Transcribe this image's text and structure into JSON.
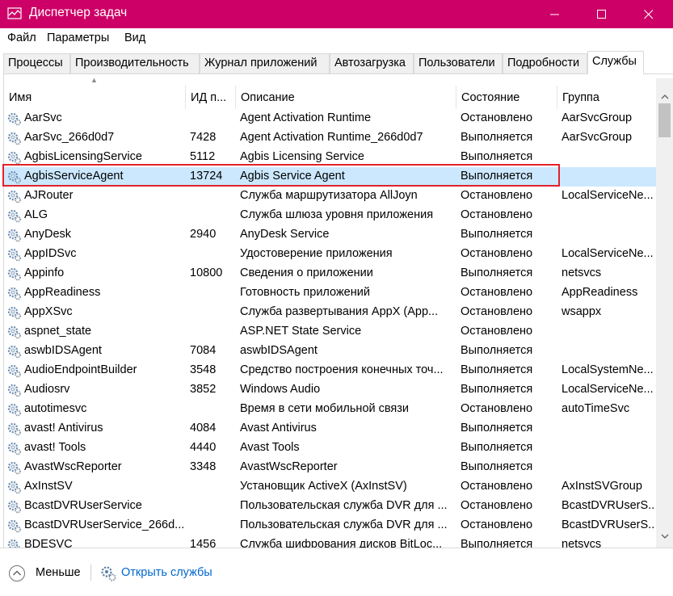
{
  "window": {
    "title": "Диспетчер задач"
  },
  "menu": [
    "Файл",
    "Параметры",
    "Вид"
  ],
  "tabs": [
    "Процессы",
    "Производительность",
    "Журнал приложений",
    "Автозагрузка",
    "Пользователи",
    "Подробности",
    "Службы"
  ],
  "active_tab": "Службы",
  "columns": {
    "name": "Имя",
    "pid": "ИД п...",
    "desc": "Описание",
    "state": "Состояние",
    "group": "Группа"
  },
  "sorted_column": "name",
  "rows": [
    {
      "name": "AarSvc",
      "pid": "",
      "desc": "Agent Activation Runtime",
      "state": "Остановлено",
      "group": "AarSvcGroup"
    },
    {
      "name": "AarSvc_266d0d7",
      "pid": "7428",
      "desc": "Agent Activation Runtime_266d0d7",
      "state": "Выполняется",
      "group": "AarSvcGroup"
    },
    {
      "name": "AgbisLicensingService",
      "pid": "5112",
      "desc": "Agbis Licensing Service",
      "state": "Выполняется",
      "group": ""
    },
    {
      "name": "AgbisServiceAgent",
      "pid": "13724",
      "desc": "Agbis Service Agent",
      "state": "Выполняется",
      "group": "",
      "selected": true
    },
    {
      "name": "AJRouter",
      "pid": "",
      "desc": "Служба маршрутизатора AllJoyn",
      "state": "Остановлено",
      "group": "LocalServiceNe..."
    },
    {
      "name": "ALG",
      "pid": "",
      "desc": "Служба шлюза уровня приложения",
      "state": "Остановлено",
      "group": ""
    },
    {
      "name": "AnyDesk",
      "pid": "2940",
      "desc": "AnyDesk Service",
      "state": "Выполняется",
      "group": ""
    },
    {
      "name": "AppIDSvc",
      "pid": "",
      "desc": "Удостоверение приложения",
      "state": "Остановлено",
      "group": "LocalServiceNe..."
    },
    {
      "name": "Appinfo",
      "pid": "10800",
      "desc": "Сведения о приложении",
      "state": "Выполняется",
      "group": "netsvcs"
    },
    {
      "name": "AppReadiness",
      "pid": "",
      "desc": "Готовность приложений",
      "state": "Остановлено",
      "group": "AppReadiness"
    },
    {
      "name": "AppXSvc",
      "pid": "",
      "desc": "Служба развертывания AppX (App...",
      "state": "Остановлено",
      "group": "wsappx"
    },
    {
      "name": "aspnet_state",
      "pid": "",
      "desc": "ASP.NET State Service",
      "state": "Остановлено",
      "group": ""
    },
    {
      "name": "aswbIDSAgent",
      "pid": "7084",
      "desc": "aswbIDSAgent",
      "state": "Выполняется",
      "group": ""
    },
    {
      "name": "AudioEndpointBuilder",
      "pid": "3548",
      "desc": "Средство построения конечных точ...",
      "state": "Выполняется",
      "group": "LocalSystemNe..."
    },
    {
      "name": "Audiosrv",
      "pid": "3852",
      "desc": "Windows Audio",
      "state": "Выполняется",
      "group": "LocalServiceNe..."
    },
    {
      "name": "autotimesvc",
      "pid": "",
      "desc": "Время в сети мобильной связи",
      "state": "Остановлено",
      "group": "autoTimeSvc"
    },
    {
      "name": "avast! Antivirus",
      "pid": "4084",
      "desc": "Avast Antivirus",
      "state": "Выполняется",
      "group": ""
    },
    {
      "name": "avast! Tools",
      "pid": "4440",
      "desc": "Avast Tools",
      "state": "Выполняется",
      "group": ""
    },
    {
      "name": "AvastWscReporter",
      "pid": "3348",
      "desc": "AvastWscReporter",
      "state": "Выполняется",
      "group": ""
    },
    {
      "name": "AxInstSV",
      "pid": "",
      "desc": "Установщик ActiveX (AxInstSV)",
      "state": "Остановлено",
      "group": "AxInstSVGroup"
    },
    {
      "name": "BcastDVRUserService",
      "pid": "",
      "desc": "Пользовательская служба DVR для ...",
      "state": "Остановлено",
      "group": "BcastDVRUserS..."
    },
    {
      "name": "BcastDVRUserService_266d...",
      "pid": "",
      "desc": "Пользовательская служба DVR для ...",
      "state": "Остановлено",
      "group": "BcastDVRUserS..."
    },
    {
      "name": "BDESVC",
      "pid": "1456",
      "desc": "Служба шифрования дисков BitLoc...",
      "state": "Выполняется",
      "group": "netsvcs"
    }
  ],
  "footer": {
    "less_label": "Меньше",
    "open_services_label": "Открыть службы"
  },
  "colors": {
    "titlebar": "#cc0066",
    "selection": "#cce8ff",
    "highlight_border": "#e0232b",
    "link": "#0066cc"
  },
  "icons": {
    "app": "task-manager-icon",
    "row": "service-gear-icon",
    "less": "chevron-up-circle-icon",
    "open_services": "services-gear-icon"
  }
}
